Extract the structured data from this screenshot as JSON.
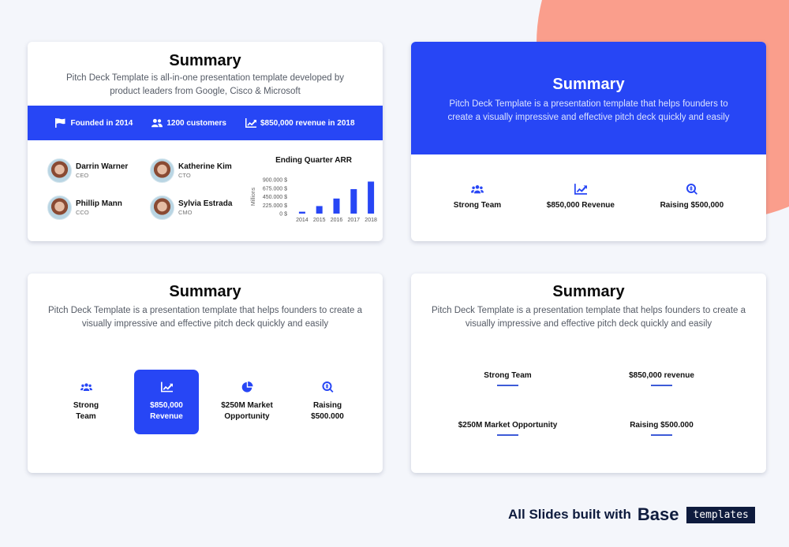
{
  "colors": {
    "accent": "#2746f5",
    "blob": "#fa9e8c",
    "background": "#f4f6fb",
    "navy": "#0e1b3d"
  },
  "slide1": {
    "title": "Summary",
    "subtitle": "Pitch Deck Template is all-in-one presentation template developed by product leaders from Google, Cisco & Microsoft",
    "strip": [
      {
        "icon": "flag-icon",
        "label": "Founded in 2014"
      },
      {
        "icon": "users-icon",
        "label": "1200 customers"
      },
      {
        "icon": "chart-line-icon",
        "label": "$850,000 revenue in 2018"
      }
    ],
    "team": [
      {
        "name": "Darrin Warner",
        "role": "CEO"
      },
      {
        "name": "Katherine Kim",
        "role": "CTO"
      },
      {
        "name": "Phillip Mann",
        "role": "CCO"
      },
      {
        "name": "Sylvia Estrada",
        "role": "CMO"
      }
    ]
  },
  "chart_data": {
    "type": "bar",
    "title": "Ending Quarter ARR",
    "ylabel": "Millions",
    "xlabel": "",
    "categories": [
      "2014",
      "2015",
      "2016",
      "2017",
      "2018"
    ],
    "values": [
      50,
      200,
      400,
      650,
      850
    ],
    "ylim": [
      0,
      900
    ],
    "yticks": [
      0,
      225,
      450,
      675,
      900
    ],
    "ytick_labels": [
      "0 $",
      "225.000 $",
      "450.000 $",
      "675.000 $",
      "900.000 $"
    ],
    "grid": false,
    "legend": "none"
  },
  "slide2": {
    "title": "Summary",
    "subtitle": "Pitch Deck Template is a presentation template that helps founders to create a visually impressive and effective pitch deck quickly and easily",
    "features": [
      {
        "icon": "users-icon",
        "label": "Strong Team"
      },
      {
        "icon": "chart-line-icon",
        "label": "$850,000 Revenue"
      },
      {
        "icon": "search-dollar-icon",
        "label": "Raising $500,000"
      }
    ]
  },
  "slide3": {
    "title": "Summary",
    "subtitle": "Pitch Deck Template is a presentation template that helps founders to create a visually impressive and effective pitch deck quickly and easily",
    "features": [
      {
        "icon": "users-icon",
        "line1": "Strong",
        "line2": "Team",
        "active": false
      },
      {
        "icon": "chart-line-icon",
        "line1": "$850,000",
        "line2": "Revenue",
        "active": true
      },
      {
        "icon": "pie-chart-icon",
        "line1": "$250M Market",
        "line2": "Opportunity",
        "active": false
      },
      {
        "icon": "search-dollar-icon",
        "line1": "Raising",
        "line2": "$500.000",
        "active": false
      }
    ]
  },
  "slide4": {
    "title": "Summary",
    "subtitle": "Pitch Deck Template is a presentation template that helps founders to create a visually impressive and effective pitch deck quickly and easily",
    "items": [
      "Strong Team",
      "$850,000 revenue",
      "$250M Market Opportunity",
      "Raising $500.000"
    ]
  },
  "footer": {
    "text": "All Slides built with",
    "brand": "Base",
    "tag": "templates"
  }
}
